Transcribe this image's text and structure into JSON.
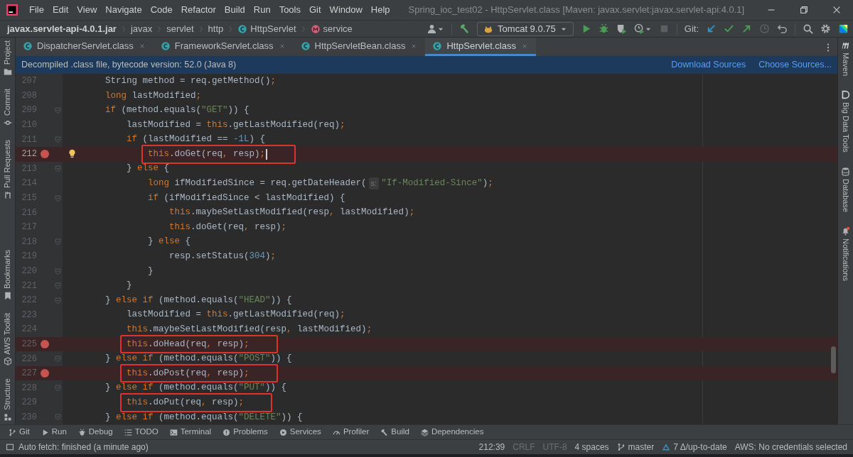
{
  "window": {
    "title": "Spring_ioc_test02 - HttpServlet.class [Maven: javax.servlet:javax.servlet-api:4.0.1]"
  },
  "menu": [
    "File",
    "Edit",
    "View",
    "Navigate",
    "Code",
    "Refactor",
    "Build",
    "Run",
    "Tools",
    "Git",
    "Window",
    "Help"
  ],
  "breadcrumbs": [
    {
      "kind": "jar",
      "label": "javax.servlet-api-4.0.1.jar"
    },
    {
      "kind": "package",
      "label": "javax"
    },
    {
      "kind": "package",
      "label": "servlet"
    },
    {
      "kind": "package",
      "label": "http"
    },
    {
      "kind": "class",
      "label": "HttpServlet"
    },
    {
      "kind": "method",
      "label": "service"
    }
  ],
  "toolbar": {
    "run_config": "Tomcat 9.0.75",
    "git_label": "Git:"
  },
  "tabs": [
    {
      "label": "DispatcherServlet.class",
      "selected": false
    },
    {
      "label": "FrameworkServlet.class",
      "selected": false
    },
    {
      "label": "HttpServletBean.class",
      "selected": false
    },
    {
      "label": "HttpServlet.class",
      "selected": true
    }
  ],
  "banner": {
    "text": "Decompiled .class file, bytecode version: 52.0 (Java 8)",
    "actions": [
      "Download Sources",
      "Choose Sources..."
    ]
  },
  "left_tools_top": [
    "Project",
    "Commit",
    "Pull Requests"
  ],
  "left_tools_bottom": [
    "Bookmarks",
    "AWS Toolkit",
    "Structure"
  ],
  "right_tools": [
    "Maven",
    "Big Data Tools",
    "Database",
    "Notifications"
  ],
  "editor": {
    "lines": [
      {
        "number": "207",
        "breakpoint": false,
        "fold": false,
        "annotated": false,
        "tokens": [
          {
            "kind": "plain",
            "text": "        String method = req.getMethod()"
          },
          {
            "kind": "punct",
            "text": ";"
          }
        ]
      },
      {
        "number": "208",
        "breakpoint": false,
        "fold": false,
        "annotated": false,
        "tokens": [
          {
            "kind": "keyword",
            "text": "        long"
          },
          {
            "kind": "plain",
            "text": " lastModified"
          },
          {
            "kind": "punct",
            "text": ";"
          }
        ]
      },
      {
        "number": "209",
        "breakpoint": false,
        "fold": true,
        "annotated": false,
        "tokens": [
          {
            "kind": "keyword",
            "text": "        if"
          },
          {
            "kind": "plain",
            "text": " (method.equals("
          },
          {
            "kind": "string",
            "text": "\"GET\""
          },
          {
            "kind": "plain",
            "text": ")) {"
          }
        ]
      },
      {
        "number": "210",
        "breakpoint": false,
        "fold": false,
        "annotated": false,
        "tokens": [
          {
            "kind": "plain",
            "text": "            lastModified = "
          },
          {
            "kind": "keyword",
            "text": "this"
          },
          {
            "kind": "plain",
            "text": ".getLastModified(req)"
          },
          {
            "kind": "punct",
            "text": ";"
          }
        ]
      },
      {
        "number": "211",
        "breakpoint": false,
        "fold": true,
        "annotated": false,
        "tokens": [
          {
            "kind": "keyword",
            "text": "            if"
          },
          {
            "kind": "plain",
            "text": " (lastModified == "
          },
          {
            "kind": "number",
            "text": "-1L"
          },
          {
            "kind": "plain",
            "text": ") {"
          }
        ]
      },
      {
        "number": "212",
        "breakpoint": true,
        "fold": false,
        "annotated": true,
        "caret": true,
        "bulb": true,
        "tokens": [
          {
            "kind": "keyword",
            "text": "                this"
          },
          {
            "kind": "plain",
            "text": ".doGet(req"
          },
          {
            "kind": "punct",
            "text": ","
          },
          {
            "kind": "plain",
            "text": " resp)"
          },
          {
            "kind": "punct",
            "text": ";"
          }
        ]
      },
      {
        "number": "213",
        "breakpoint": false,
        "fold": true,
        "annotated": false,
        "tokens": [
          {
            "kind": "plain",
            "text": "            } "
          },
          {
            "kind": "keyword",
            "text": "else"
          },
          {
            "kind": "plain",
            "text": " {"
          }
        ]
      },
      {
        "number": "214",
        "breakpoint": false,
        "fold": false,
        "annotated": false,
        "tokens": [
          {
            "kind": "keyword",
            "text": "                long"
          },
          {
            "kind": "plain",
            "text": " ifModifiedSince = req.getDateHeader("
          },
          {
            "kind": "hint",
            "text": "s:"
          },
          {
            "kind": "string",
            "text": "\"If-Modified-Since\""
          },
          {
            "kind": "plain",
            "text": ")"
          },
          {
            "kind": "punct",
            "text": ";"
          }
        ]
      },
      {
        "number": "215",
        "breakpoint": false,
        "fold": true,
        "annotated": false,
        "tokens": [
          {
            "kind": "keyword",
            "text": "                if"
          },
          {
            "kind": "plain",
            "text": " (ifModifiedSince < lastModified) {"
          }
        ]
      },
      {
        "number": "216",
        "breakpoint": false,
        "fold": false,
        "annotated": false,
        "tokens": [
          {
            "kind": "keyword",
            "text": "                    this"
          },
          {
            "kind": "plain",
            "text": ".maybeSetLastModified(resp"
          },
          {
            "kind": "punct",
            "text": ","
          },
          {
            "kind": "plain",
            "text": " lastModified)"
          },
          {
            "kind": "punct",
            "text": ";"
          }
        ]
      },
      {
        "number": "217",
        "breakpoint": false,
        "fold": false,
        "annotated": false,
        "tokens": [
          {
            "kind": "keyword",
            "text": "                    this"
          },
          {
            "kind": "plain",
            "text": ".doGet(req"
          },
          {
            "kind": "punct",
            "text": ","
          },
          {
            "kind": "plain",
            "text": " resp)"
          },
          {
            "kind": "punct",
            "text": ";"
          }
        ]
      },
      {
        "number": "218",
        "breakpoint": false,
        "fold": true,
        "annotated": false,
        "tokens": [
          {
            "kind": "plain",
            "text": "                } "
          },
          {
            "kind": "keyword",
            "text": "else"
          },
          {
            "kind": "plain",
            "text": " {"
          }
        ]
      },
      {
        "number": "219",
        "breakpoint": false,
        "fold": false,
        "annotated": false,
        "tokens": [
          {
            "kind": "plain",
            "text": "                    resp.setStatus("
          },
          {
            "kind": "number",
            "text": "304"
          },
          {
            "kind": "plain",
            "text": ")"
          },
          {
            "kind": "punct",
            "text": ";"
          }
        ]
      },
      {
        "number": "220",
        "breakpoint": false,
        "fold": true,
        "annotated": false,
        "tokens": [
          {
            "kind": "plain",
            "text": "                }"
          }
        ]
      },
      {
        "number": "221",
        "breakpoint": false,
        "fold": true,
        "annotated": false,
        "tokens": [
          {
            "kind": "plain",
            "text": "            }"
          }
        ]
      },
      {
        "number": "222",
        "breakpoint": false,
        "fold": true,
        "annotated": false,
        "tokens": [
          {
            "kind": "plain",
            "text": "        } "
          },
          {
            "kind": "keyword",
            "text": "else if"
          },
          {
            "kind": "plain",
            "text": " (method.equals("
          },
          {
            "kind": "string",
            "text": "\"HEAD\""
          },
          {
            "kind": "plain",
            "text": ")) {"
          }
        ]
      },
      {
        "number": "223",
        "breakpoint": false,
        "fold": false,
        "annotated": false,
        "tokens": [
          {
            "kind": "plain",
            "text": "            lastModified = "
          },
          {
            "kind": "keyword",
            "text": "this"
          },
          {
            "kind": "plain",
            "text": ".getLastModified(req)"
          },
          {
            "kind": "punct",
            "text": ";"
          }
        ]
      },
      {
        "number": "224",
        "breakpoint": false,
        "fold": false,
        "annotated": false,
        "tokens": [
          {
            "kind": "keyword",
            "text": "            this"
          },
          {
            "kind": "plain",
            "text": ".maybeSetLastModified(resp"
          },
          {
            "kind": "punct",
            "text": ","
          },
          {
            "kind": "plain",
            "text": " lastModified)"
          },
          {
            "kind": "punct",
            "text": ";"
          }
        ]
      },
      {
        "number": "225",
        "breakpoint": true,
        "fold": false,
        "annotated": true,
        "tokens": [
          {
            "kind": "keyword",
            "text": "            this"
          },
          {
            "kind": "plain",
            "text": ".doHead(req"
          },
          {
            "kind": "punct",
            "text": ","
          },
          {
            "kind": "plain",
            "text": " resp)"
          },
          {
            "kind": "punct",
            "text": ";"
          }
        ]
      },
      {
        "number": "226",
        "breakpoint": false,
        "fold": true,
        "annotated": false,
        "tokens": [
          {
            "kind": "plain",
            "text": "        } "
          },
          {
            "kind": "keyword",
            "text": "else if"
          },
          {
            "kind": "plain",
            "text": " (method.equals("
          },
          {
            "kind": "string",
            "text": "\"POST\""
          },
          {
            "kind": "plain",
            "text": ")) {"
          }
        ]
      },
      {
        "number": "227",
        "breakpoint": true,
        "fold": false,
        "annotated": true,
        "tokens": [
          {
            "kind": "keyword",
            "text": "            this"
          },
          {
            "kind": "plain",
            "text": ".doPost(req"
          },
          {
            "kind": "punct",
            "text": ","
          },
          {
            "kind": "plain",
            "text": " resp)"
          },
          {
            "kind": "punct",
            "text": ";"
          }
        ]
      },
      {
        "number": "228",
        "breakpoint": false,
        "fold": true,
        "annotated": false,
        "tokens": [
          {
            "kind": "plain",
            "text": "        } "
          },
          {
            "kind": "keyword",
            "text": "else if"
          },
          {
            "kind": "plain",
            "text": " (method.equals("
          },
          {
            "kind": "string",
            "text": "\"PUT\""
          },
          {
            "kind": "plain",
            "text": ")) {"
          }
        ]
      },
      {
        "number": "229",
        "breakpoint": false,
        "fold": false,
        "annotated": true,
        "tokens": [
          {
            "kind": "keyword",
            "text": "            this"
          },
          {
            "kind": "plain",
            "text": ".doPut(req"
          },
          {
            "kind": "punct",
            "text": ","
          },
          {
            "kind": "plain",
            "text": " resp)"
          },
          {
            "kind": "punct",
            "text": ";"
          }
        ]
      },
      {
        "number": "230",
        "breakpoint": false,
        "fold": true,
        "annotated": false,
        "tokens": [
          {
            "kind": "plain",
            "text": "        } "
          },
          {
            "kind": "keyword",
            "text": "else if"
          },
          {
            "kind": "plain",
            "text": " (method.equals("
          },
          {
            "kind": "string",
            "text": "\"DELETE\""
          },
          {
            "kind": "plain",
            "text": ")) {"
          }
        ]
      }
    ]
  },
  "tool_windows": [
    "Git",
    "Run",
    "Debug",
    "TODO",
    "Terminal",
    "Problems",
    "Services",
    "Profiler",
    "Build",
    "Dependencies"
  ],
  "status_bar": {
    "message": "Auto fetch: finished (a minute ago)",
    "items": [
      {
        "kind": "text",
        "label": "212:39"
      },
      {
        "kind": "dim",
        "label": "CRLF"
      },
      {
        "kind": "dim",
        "label": "UTF-8"
      },
      {
        "kind": "text",
        "label": "4 spaces"
      },
      {
        "kind": "branch",
        "label": "master"
      },
      {
        "kind": "vcs",
        "label": "7 Δ/up-to-date"
      },
      {
        "kind": "text",
        "label": "AWS: No credentials selected"
      }
    ]
  }
}
